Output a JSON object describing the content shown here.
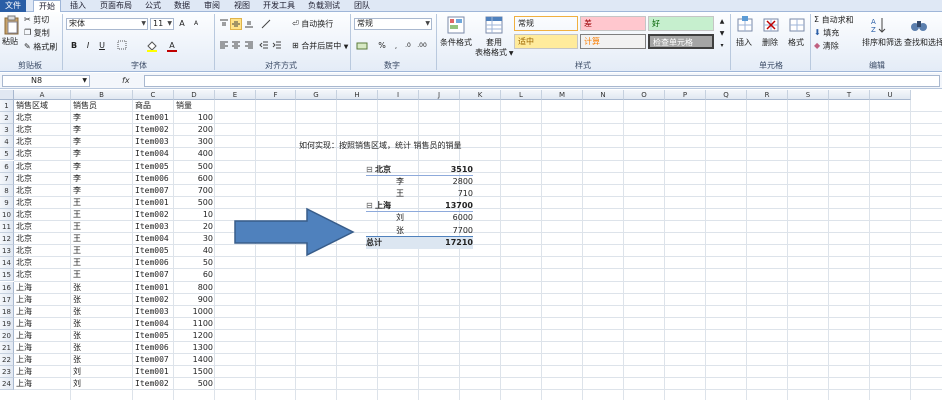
{
  "ribbon_tabs": [
    "文件",
    "开始",
    "插入",
    "页面布局",
    "公式",
    "数据",
    "审阅",
    "视图",
    "开发工具",
    "负载测试",
    "团队"
  ],
  "clipboard": {
    "paste": "粘贴",
    "cut": "剪切",
    "copy": "复制",
    "format_painter": "格式刷",
    "label": "剪贴板"
  },
  "font": {
    "name": "宋体",
    "size": "11",
    "label": "字体",
    "bold": "B",
    "italic": "I",
    "underline": "U"
  },
  "alignment": {
    "wrap_text": "自动换行",
    "merge_center": "合并后居中",
    "label": "对齐方式"
  },
  "number": {
    "format": "常规",
    "label": "数字"
  },
  "styles": {
    "conditional_formatting": "条件格式",
    "format_as_table_1": "套用",
    "format_as_table_2": "表格格式",
    "cells": [
      {
        "text": "常规",
        "bg": "#ffffff",
        "fg": "#000000"
      },
      {
        "text": "差",
        "bg": "#ffc7ce",
        "fg": "#9c0006"
      },
      {
        "text": "好",
        "bg": "#c6efce",
        "fg": "#006100"
      },
      {
        "text": "适中",
        "bg": "#ffeb9c",
        "fg": "#9c6500"
      },
      {
        "text": "计算",
        "bg": "#f2f2f2",
        "fg": "#fa7d00"
      },
      {
        "text": "检查单元格",
        "bg": "#a5a5a5",
        "fg": "#ffffff"
      }
    ],
    "label": "样式"
  },
  "cells_group": {
    "insert": "插入",
    "delete": "删除",
    "format": "格式",
    "label": "单元格"
  },
  "editing": {
    "autosum": "自动求和",
    "fill": "填充",
    "clear": "清除",
    "sort_filter": "排序和筛选",
    "find_select": "查找和选择",
    "label": "编辑"
  },
  "formula_bar": {
    "name_box": "N8",
    "fx": "fx",
    "value": ""
  },
  "columns": [
    "A",
    "B",
    "C",
    "D",
    "E",
    "F",
    "G",
    "H",
    "I",
    "J",
    "K",
    "L",
    "M",
    "N",
    "O",
    "P",
    "Q",
    "R",
    "S",
    "T",
    "U"
  ],
  "rows": [
    {
      "n": "1",
      "a": "销售区域",
      "b": "销售员",
      "c": "商品",
      "d": "销量"
    },
    {
      "n": "2",
      "a": "北京",
      "b": "李",
      "c": "Item001",
      "d": "100"
    },
    {
      "n": "3",
      "a": "北京",
      "b": "李",
      "c": "Item002",
      "d": "200"
    },
    {
      "n": "4",
      "a": "北京",
      "b": "李",
      "c": "Item003",
      "d": "300"
    },
    {
      "n": "5",
      "a": "北京",
      "b": "李",
      "c": "Item004",
      "d": "400"
    },
    {
      "n": "6",
      "a": "北京",
      "b": "李",
      "c": "Item005",
      "d": "500"
    },
    {
      "n": "7",
      "a": "北京",
      "b": "李",
      "c": "Item006",
      "d": "600"
    },
    {
      "n": "8",
      "a": "北京",
      "b": "李",
      "c": "Item007",
      "d": "700"
    },
    {
      "n": "9",
      "a": "北京",
      "b": "王",
      "c": "Item001",
      "d": "500"
    },
    {
      "n": "10",
      "a": "北京",
      "b": "王",
      "c": "Item002",
      "d": "10"
    },
    {
      "n": "11",
      "a": "北京",
      "b": "王",
      "c": "Item003",
      "d": "20"
    },
    {
      "n": "12",
      "a": "北京",
      "b": "王",
      "c": "Item004",
      "d": "30"
    },
    {
      "n": "13",
      "a": "北京",
      "b": "王",
      "c": "Item005",
      "d": "40"
    },
    {
      "n": "14",
      "a": "北京",
      "b": "王",
      "c": "Item006",
      "d": "50"
    },
    {
      "n": "15",
      "a": "北京",
      "b": "王",
      "c": "Item007",
      "d": "60"
    },
    {
      "n": "16",
      "a": "上海",
      "b": "张",
      "c": "Item001",
      "d": "800"
    },
    {
      "n": "17",
      "a": "上海",
      "b": "张",
      "c": "Item002",
      "d": "900"
    },
    {
      "n": "18",
      "a": "上海",
      "b": "张",
      "c": "Item003",
      "d": "1000"
    },
    {
      "n": "19",
      "a": "上海",
      "b": "张",
      "c": "Item004",
      "d": "1100"
    },
    {
      "n": "20",
      "a": "上海",
      "b": "张",
      "c": "Item005",
      "d": "1200"
    },
    {
      "n": "21",
      "a": "上海",
      "b": "张",
      "c": "Item006",
      "d": "1300"
    },
    {
      "n": "22",
      "a": "上海",
      "b": "张",
      "c": "Item007",
      "d": "1400"
    },
    {
      "n": "23",
      "a": "上海",
      "b": "刘",
      "c": "Item001",
      "d": "1500"
    },
    {
      "n": "24",
      "a": "上海",
      "b": "刘",
      "c": "Item002",
      "d": "500"
    }
  ],
  "question": "如何实现：按照销售区域，统计  销售员的销量",
  "pivot": {
    "groups": [
      {
        "name": "北京",
        "total": "3510",
        "items": [
          {
            "name": "李",
            "value": "2800"
          },
          {
            "name": "王",
            "value": "710"
          }
        ]
      },
      {
        "name": "上海",
        "total": "13700",
        "items": [
          {
            "name": "刘",
            "value": "6000"
          },
          {
            "name": "张",
            "value": "7700"
          }
        ]
      }
    ],
    "grand_total_label": "总计",
    "grand_total": "17210",
    "collapse_symbol": "⊟"
  },
  "arrow_color": "#4f81bd"
}
